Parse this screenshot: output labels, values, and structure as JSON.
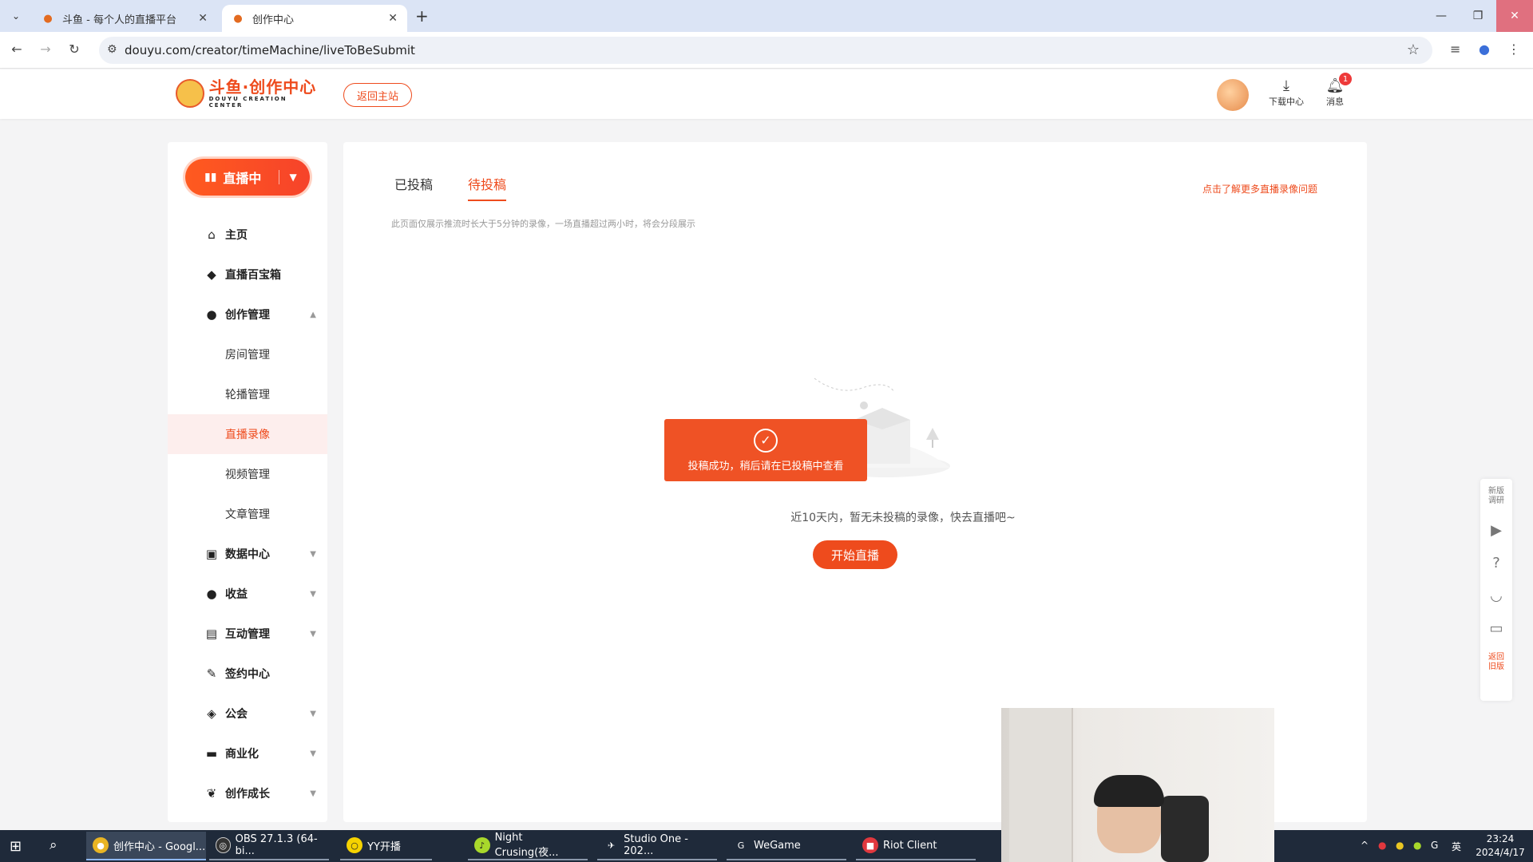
{
  "browser": {
    "tabs": [
      {
        "title": "斗鱼 - 每个人的直播平台"
      },
      {
        "title": "创作中心"
      }
    ],
    "url": "douyu.com/creator/timeMachine/liveToBeSubmit"
  },
  "header": {
    "logo_main": "斗鱼·创作中心",
    "logo_sub": "DOUYU CREATION CENTER",
    "back_label": "返回主站",
    "download_label": "下载中心",
    "message_label": "消息",
    "message_badge": "1"
  },
  "sidebar": {
    "live_button": "直播中",
    "items": [
      {
        "label": "主页",
        "icon": "home-icon"
      },
      {
        "label": "直播百宝箱",
        "icon": "cube-icon"
      },
      {
        "label": "创作管理",
        "icon": "bulb-icon"
      },
      {
        "label": "数据中心",
        "icon": "chart-icon"
      },
      {
        "label": "收益",
        "icon": "coin-icon"
      },
      {
        "label": "互动管理",
        "icon": "chat-icon"
      },
      {
        "label": "签约中心",
        "icon": "pen-icon"
      },
      {
        "label": "公会",
        "icon": "shield-icon"
      },
      {
        "label": "商业化",
        "icon": "briefcase-icon"
      },
      {
        "label": "创作成长",
        "icon": "sprout-icon"
      }
    ],
    "sub_items": [
      {
        "label": "房间管理"
      },
      {
        "label": "轮播管理"
      },
      {
        "label": "直播录像"
      },
      {
        "label": "视频管理"
      },
      {
        "label": "文章管理"
      }
    ]
  },
  "main": {
    "tabs": [
      {
        "label": "已投稿"
      },
      {
        "label": "待投稿"
      }
    ],
    "help_link": "点击了解更多直播录像问题",
    "notice": "此页面仅展示推流时长大于5分钟的录像，一场直播超过两小时，将会分段展示",
    "toast": "投稿成功，稍后请在已投稿中查看",
    "empty_text": "近10天内，暂无未投稿的录像，快去直播吧~",
    "start_live": "开始直播"
  },
  "float_bar": {
    "survey": "新版调研",
    "old_version": "返回旧版"
  },
  "taskbar": {
    "items": [
      {
        "label": "创作中心 - Googl..."
      },
      {
        "label": "OBS 27.1.3 (64-bi..."
      },
      {
        "label": "YY开播"
      },
      {
        "label": "Night Crusing(夜..."
      },
      {
        "label": "Studio One - 202..."
      },
      {
        "label": "WeGame"
      },
      {
        "label": "Riot Client"
      }
    ],
    "ime": "英",
    "time": "23:24",
    "date": "2024/4/17"
  }
}
